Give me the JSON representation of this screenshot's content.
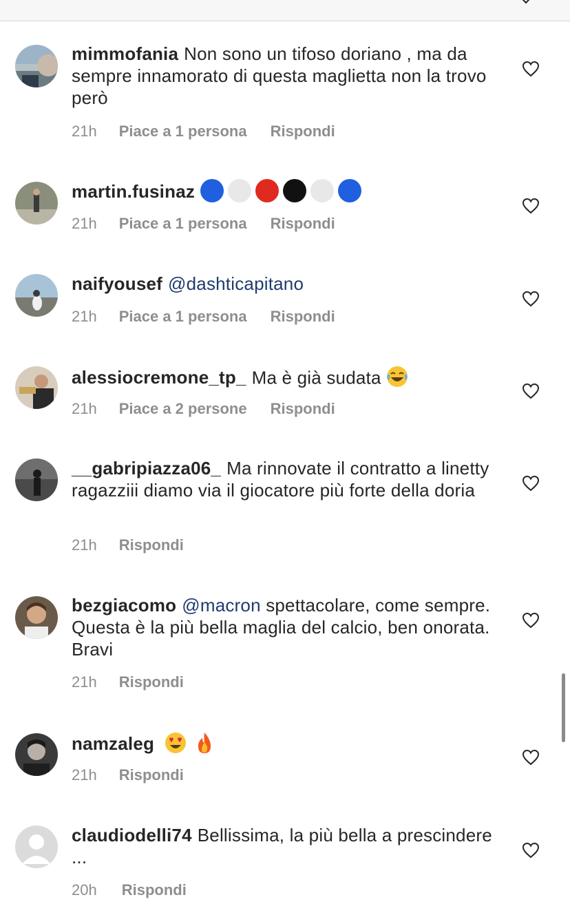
{
  "comments": [
    {
      "username": "mimmofania",
      "text": "Non sono un tifoso doriano , ma da sempre innamorato di questa maglietta non la trovo però",
      "time": "21h",
      "likes": "Piace a 1 persona",
      "reply": "Rispondi"
    },
    {
      "username": "martin.fusinaz",
      "text": "",
      "time": "21h",
      "likes": "Piace a 1 persona",
      "reply": "Rispondi",
      "emoji_circles": [
        "#1f5fe0",
        "#e8e8e8",
        "#e02a1f",
        "#111111",
        "#e8e8e8",
        "#1f5fe0"
      ]
    },
    {
      "username": "naifyousef",
      "mention": "@dashticapitano",
      "text": "",
      "time": "21h",
      "likes": "Piace a 1 persona",
      "reply": "Rispondi"
    },
    {
      "username": "alessiocremone_tp_",
      "text": "Ma è già sudata",
      "emoji": "laughing-tears-emoji",
      "time": "21h",
      "likes": "Piace a 2 persone",
      "reply": "Rispondi"
    },
    {
      "username": "__gabripiazza06_",
      "text": "Ma rinnovate il contratto a linetty ragazziii diamo via il giocatore più forte della doria",
      "time": "21h",
      "reply": "Rispondi"
    },
    {
      "username": "bezgiacomo",
      "mention": "@macron",
      "text": "spettacolare, come sempre. Questa è la più bella maglia del calcio, ben onorata. Bravi",
      "time": "21h",
      "reply": "Rispondi"
    },
    {
      "username": "namzaleg",
      "text": "",
      "emojis": [
        "heart-eyes-emoji",
        "fire-emoji"
      ],
      "time": "21h",
      "reply": "Rispondi"
    },
    {
      "username": "claudiodelli74",
      "text": "Bellissima, la più bella a prescindere ...",
      "time": "20h",
      "reply": "Rispondi"
    }
  ],
  "colors": {
    "mention": "#1f3c6e",
    "meta": "#8e8e8e",
    "text": "#262626"
  }
}
